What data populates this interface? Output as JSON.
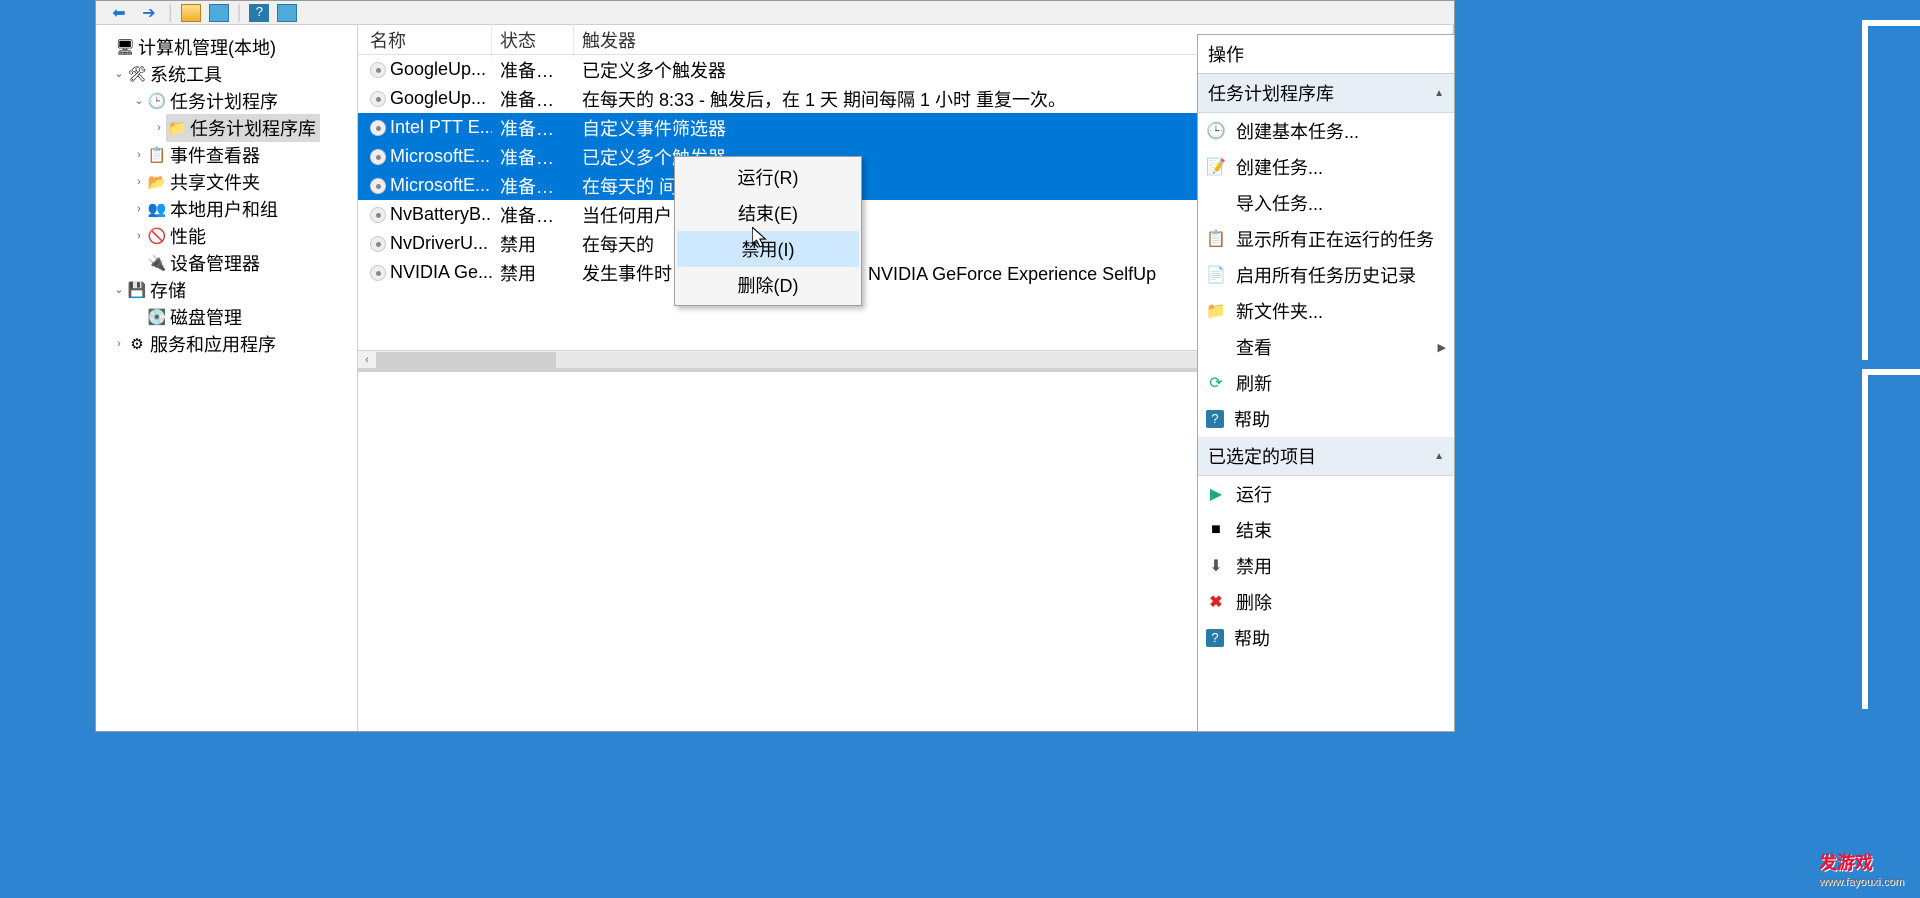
{
  "tree": {
    "root": "计算机管理(本地)",
    "system_tools": "系统工具",
    "task_scheduler": "任务计划程序",
    "task_library": "任务计划程序库",
    "event_viewer": "事件查看器",
    "shared_folders": "共享文件夹",
    "local_users": "本地用户和组",
    "performance": "性能",
    "device_manager": "设备管理器",
    "storage": "存储",
    "disk_mgmt": "磁盘管理",
    "services_apps": "服务和应用程序"
  },
  "list": {
    "cols": {
      "name": "名称",
      "status": "状态",
      "trigger": "触发器"
    },
    "rows": [
      {
        "name": "GoogleUp...",
        "status": "准备就绪",
        "trigger": "已定义多个触发器",
        "selected": false
      },
      {
        "name": "GoogleUp...",
        "status": "准备就绪",
        "trigger": "在每天的 8:33 - 触发后，在 1 天 期间每隔 1 小时 重复一次。",
        "selected": false
      },
      {
        "name": "Intel PTT E...",
        "status": "准备就绪",
        "trigger": "自定义事件筛选器",
        "selected": true
      },
      {
        "name": "MicrosoftE...",
        "status": "准备就绪",
        "trigger": "已定义多个触发器",
        "selected": true
      },
      {
        "name": "MicrosoftE...",
        "status": "准备就绪",
        "trigger": "在每天的                                                间每隔 1 小时 重复一次。",
        "selected": true
      },
      {
        "name": "NvBatteryB...",
        "status": "准备就绪",
        "trigger": "当任何用户",
        "selected": false
      },
      {
        "name": "NvDriverU...",
        "status": "禁用",
        "trigger": "在每天的",
        "selected": false
      },
      {
        "name": "NVIDIA Ge...",
        "status": "禁用",
        "trigger": "发生事件时 - 日志: Application，源: NVIDIA GeForce Experience SelfUp",
        "selected": false
      }
    ]
  },
  "context_menu": {
    "run": "运行(R)",
    "end": "结束(E)",
    "disable": "禁用(I)",
    "delete": "删除(D)"
  },
  "actions": {
    "panel_title": "操作",
    "section1": "任务计划程序库",
    "create_basic": "创建基本任务...",
    "create_task": "创建任务...",
    "import": "导入任务...",
    "show_running": "显示所有正在运行的任务",
    "enable_history": "启用所有任务历史记录",
    "new_folder": "新文件夹...",
    "view": "查看",
    "refresh": "刷新",
    "help": "帮助",
    "section2": "已选定的项目",
    "run": "运行",
    "end": "结束",
    "disable": "禁用",
    "delete": "删除",
    "help2": "帮助"
  },
  "watermark": {
    "brand": "发游戏",
    "url": "www.fayouxi.com"
  }
}
